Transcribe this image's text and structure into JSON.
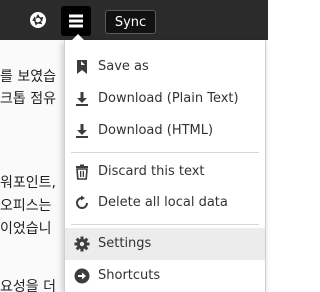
{
  "toolbar": {
    "aperture_icon": "aperture-icon",
    "menu_icon": "hamburger-menu-icon",
    "sync_label": "Sync"
  },
  "document": {
    "lines": [
      "를 보였습",
      "크톱 점유",
      "워포인트,",
      "오피스는",
      "이었습니",
      "요성을 더"
    ]
  },
  "menu": {
    "items": [
      {
        "label": "Save as",
        "icon": "bookmark-icon"
      },
      {
        "label": "Download (Plain Text)",
        "icon": "download-icon"
      },
      {
        "label": "Download (HTML)",
        "icon": "download-icon"
      },
      {
        "label": "Discard this text",
        "icon": "trash-icon"
      },
      {
        "label": "Delete all local data",
        "icon": "refresh-icon"
      },
      {
        "label": "Settings",
        "icon": "gear-icon"
      },
      {
        "label": "Shortcuts",
        "icon": "arrow-right-circle-icon"
      }
    ],
    "hovered_item": "Settings"
  }
}
